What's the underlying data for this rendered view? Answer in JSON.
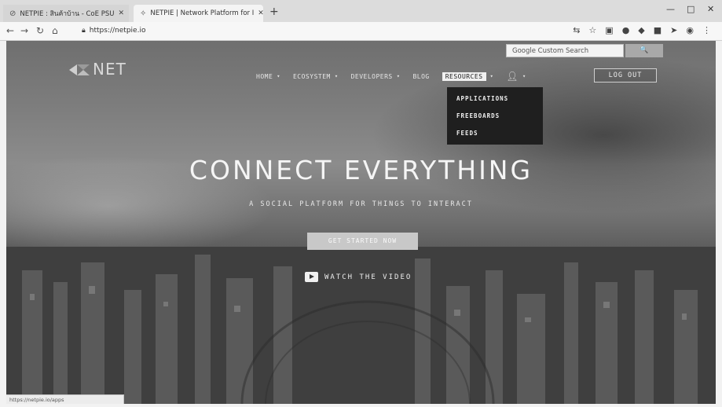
{
  "browser": {
    "tabs": [
      {
        "title": "NETPIE : สินค้าบ้าน - CoE PSU",
        "active": false,
        "icon": "globe-icon"
      },
      {
        "title": "NETPIE | Network Platform for I",
        "active": true,
        "icon": "netpie-favicon-icon"
      }
    ],
    "new_tab_label": "+",
    "url": "https://netpie.io",
    "status_url": "https://netpie.io/apps"
  },
  "site": {
    "logo_text": "NET",
    "search": {
      "placeholder": "Google Custom Search",
      "button_label": "🔍"
    },
    "nav": [
      {
        "label": "HOME",
        "dropdown": true
      },
      {
        "label": "ECOSYSTEM",
        "dropdown": true
      },
      {
        "label": "DEVELOPERS",
        "dropdown": true
      },
      {
        "label": "BLOG",
        "dropdown": false
      },
      {
        "label": "RESOURCES",
        "dropdown": true,
        "active": true
      }
    ],
    "logout_label": "LOG OUT",
    "resources_menu": [
      "APPLICATIONS",
      "FREEBOARDS",
      "FEEDS"
    ],
    "hero": {
      "headline": "CONNECT EVERYTHING",
      "subheadline": "A SOCIAL PLATFORM FOR THINGS TO INTERACT",
      "cta_label": "GET STARTED NOW",
      "video_label": "WATCH THE VIDEO"
    }
  },
  "colors": {
    "dropdown_bg": "#1f1f1f",
    "hero_text": "#f5f5f5",
    "cta_bg": "#c8c8c8"
  }
}
